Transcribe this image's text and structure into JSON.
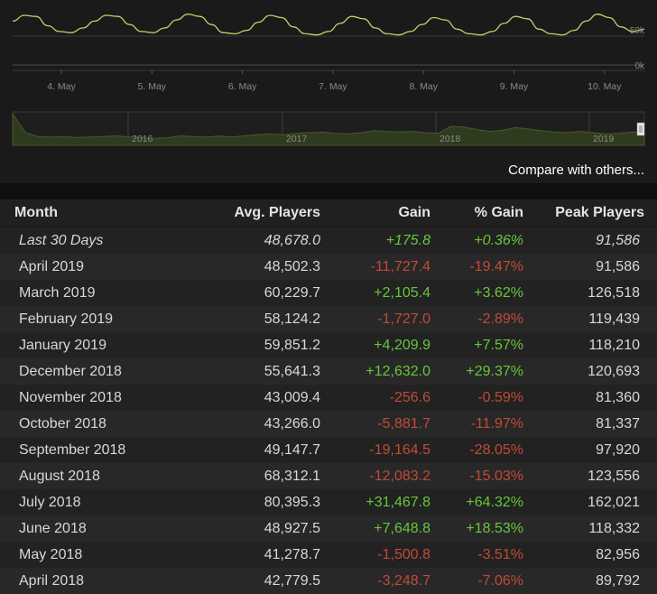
{
  "chart_data": [
    {
      "type": "line",
      "x_ticks": [
        "4. May",
        "5. May",
        "6. May",
        "7. May",
        "8. May",
        "9. May",
        "10. May"
      ],
      "y_ticks": [
        "50k",
        "0k"
      ],
      "ylim": [
        0,
        100000
      ],
      "y_values": [
        76000,
        86000,
        84000,
        68000,
        58000,
        56000,
        64000,
        76000,
        86000,
        84000,
        70000,
        58000,
        56000,
        64000,
        78000,
        88000,
        84000,
        70000,
        56000,
        54000,
        60000,
        74000,
        86000,
        82000,
        66000,
        54000,
        52000,
        58000,
        72000,
        84000,
        80000,
        64000,
        54000,
        52000,
        58000,
        70000,
        82000,
        78000,
        62000,
        54000,
        52000,
        58000,
        72000,
        84000,
        80000,
        62000,
        54000,
        52000,
        60000,
        76000,
        88000,
        82000,
        66000,
        58000,
        62000
      ]
    },
    {
      "type": "area",
      "x_ticks": [
        "2016",
        "2017",
        "2018",
        "2019"
      ],
      "y_values": [
        100,
        40,
        28,
        26,
        27,
        25,
        26,
        28,
        30,
        27,
        24,
        22,
        24,
        30,
        28,
        26,
        29,
        27,
        30,
        34,
        36,
        33,
        38,
        40,
        42,
        38,
        36,
        40,
        46,
        44,
        42,
        44,
        40,
        38,
        60,
        58,
        50,
        44,
        48,
        56,
        52,
        46,
        42,
        40,
        44,
        40,
        36,
        38,
        42,
        40
      ]
    }
  ],
  "compare_link": "Compare with others...",
  "table": {
    "headers": [
      "Month",
      "Avg. Players",
      "Gain",
      "% Gain",
      "Peak Players"
    ],
    "rows": [
      {
        "month": "Last 30 Days",
        "avg": "48,678.0",
        "gain": "+175.8",
        "pgain": "+0.36%",
        "peak": "91,586",
        "trend": "pos",
        "italic": true
      },
      {
        "month": "April 2019",
        "avg": "48,502.3",
        "gain": "-11,727.4",
        "pgain": "-19.47%",
        "peak": "91,586",
        "trend": "neg"
      },
      {
        "month": "March 2019",
        "avg": "60,229.7",
        "gain": "+2,105.4",
        "pgain": "+3.62%",
        "peak": "126,518",
        "trend": "pos"
      },
      {
        "month": "February 2019",
        "avg": "58,124.2",
        "gain": "-1,727.0",
        "pgain": "-2.89%",
        "peak": "119,439",
        "trend": "neg"
      },
      {
        "month": "January 2019",
        "avg": "59,851.2",
        "gain": "+4,209.9",
        "pgain": "+7.57%",
        "peak": "118,210",
        "trend": "pos"
      },
      {
        "month": "December 2018",
        "avg": "55,641.3",
        "gain": "+12,632.0",
        "pgain": "+29.37%",
        "peak": "120,693",
        "trend": "pos"
      },
      {
        "month": "November 2018",
        "avg": "43,009.4",
        "gain": "-256.6",
        "pgain": "-0.59%",
        "peak": "81,360",
        "trend": "neg"
      },
      {
        "month": "October 2018",
        "avg": "43,266.0",
        "gain": "-5,881.7",
        "pgain": "-11.97%",
        "peak": "81,337",
        "trend": "neg"
      },
      {
        "month": "September 2018",
        "avg": "49,147.7",
        "gain": "-19,164.5",
        "pgain": "-28.05%",
        "peak": "97,920",
        "trend": "neg"
      },
      {
        "month": "August 2018",
        "avg": "68,312.1",
        "gain": "-12,083.2",
        "pgain": "-15.03%",
        "peak": "123,556",
        "trend": "neg"
      },
      {
        "month": "July 2018",
        "avg": "80,395.3",
        "gain": "+31,467.8",
        "pgain": "+64.32%",
        "peak": "162,021",
        "trend": "pos"
      },
      {
        "month": "June 2018",
        "avg": "48,927.5",
        "gain": "+7,648.8",
        "pgain": "+18.53%",
        "peak": "118,332",
        "trend": "pos"
      },
      {
        "month": "May 2018",
        "avg": "41,278.7",
        "gain": "-1,500.8",
        "pgain": "-3.51%",
        "peak": "82,956",
        "trend": "neg"
      },
      {
        "month": "April 2018",
        "avg": "42,779.5",
        "gain": "-3,248.7",
        "pgain": "-7.06%",
        "peak": "89,792",
        "trend": "neg"
      }
    ]
  },
  "colors": {
    "line": "#b5d86a",
    "area": "#2f3b1e",
    "positive": "#67c73a",
    "negative": "#c14b36"
  }
}
